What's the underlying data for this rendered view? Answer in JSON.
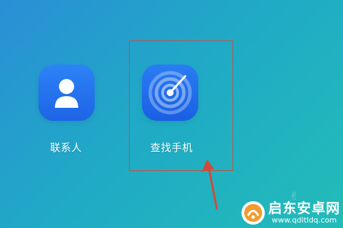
{
  "apps": [
    {
      "label": "联系人",
      "icon": "contacts-person-icon"
    },
    {
      "label": "查找手机",
      "icon": "find-phone-radar-icon"
    }
  ],
  "colors": {
    "background_start": "#2a8fd6",
    "background_end": "#22bcb8",
    "icon_blue": "#1d64e6",
    "highlight": "#d04a3a"
  },
  "watermark": {
    "title": "启东安卓网",
    "url": "www.qdltldq.com"
  }
}
